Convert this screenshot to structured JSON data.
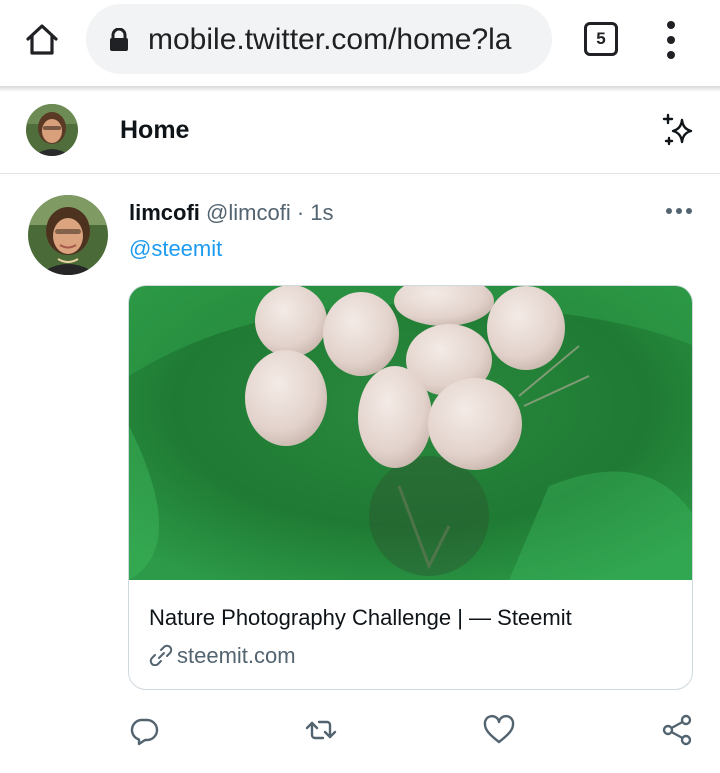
{
  "browser": {
    "url": "mobile.twitter.com/home?la",
    "tab_count": "5"
  },
  "header": {
    "title": "Home"
  },
  "tweet": {
    "author_name": "limcofi",
    "author_handle": "@limcofi",
    "separator": "·",
    "time": "1s",
    "text": "@steemit",
    "card": {
      "title": "Nature Photography Challenge | — Steemit",
      "domain": "steemit.com",
      "image_description": "eggs-in-green-bowl"
    }
  },
  "colors": {
    "link_blue": "#1d9bf0",
    "secondary_text": "#536471",
    "url_bar_bg": "#f1f3f4",
    "divider": "#e1e5e8"
  },
  "icons": {
    "home": "home-icon",
    "lock": "lock-icon",
    "menu": "more-vert-icon",
    "sparkle": "sparkle-icon",
    "more": "more-horiz-icon",
    "reply": "reply-icon",
    "retweet": "retweet-icon",
    "like": "heart-icon",
    "share": "share-icon",
    "link": "link-icon"
  }
}
